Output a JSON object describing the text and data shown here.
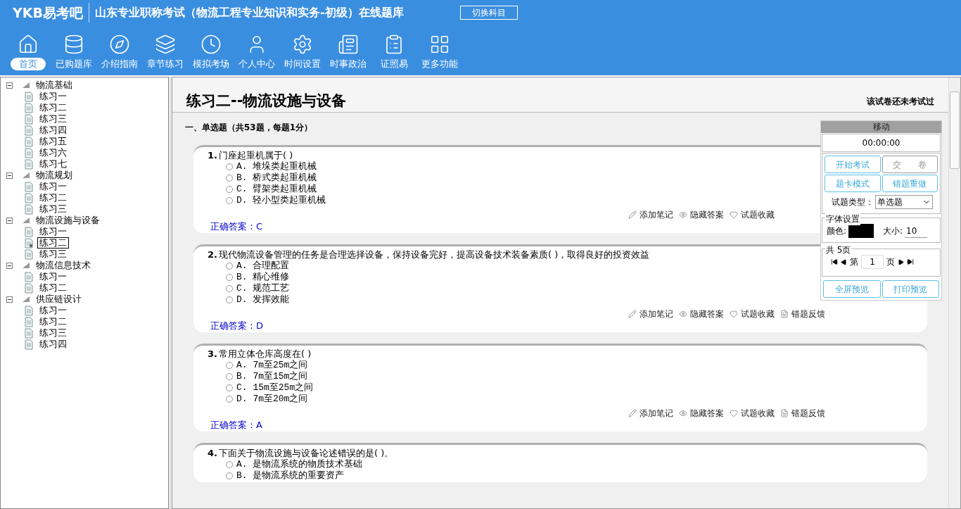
{
  "header": {
    "logo": "YKB易考吧",
    "title": "山东专业职称考试（物流工程专业知识和实务-初级）在线题库",
    "switch_button": "切换科目"
  },
  "nav": [
    {
      "label": "首页",
      "selected": true
    },
    {
      "label": "已购题库",
      "selected": false
    },
    {
      "label": "介绍指南",
      "selected": false
    },
    {
      "label": "章节练习",
      "selected": false
    },
    {
      "label": "模拟考场",
      "selected": false
    },
    {
      "label": "个人中心",
      "selected": false
    },
    {
      "label": "时间设置",
      "selected": false
    },
    {
      "label": "时事政治",
      "selected": false
    },
    {
      "label": "证照易",
      "selected": false
    },
    {
      "label": "更多功能",
      "selected": false
    }
  ],
  "tree": [
    {
      "label": "物流基础",
      "expanded": true,
      "children": [
        {
          "label": "练习一",
          "selected": false
        },
        {
          "label": "练习二",
          "selected": false
        },
        {
          "label": "练习三",
          "selected": false
        },
        {
          "label": "练习四",
          "selected": false
        },
        {
          "label": "练习五",
          "selected": false
        },
        {
          "label": "练习六",
          "selected": false
        },
        {
          "label": "练习七",
          "selected": false
        }
      ]
    },
    {
      "label": "物流规划",
      "expanded": true,
      "children": [
        {
          "label": "练习一",
          "selected": false
        },
        {
          "label": "练习二",
          "selected": false
        },
        {
          "label": "练习三",
          "selected": false
        }
      ]
    },
    {
      "label": "物流设施与设备",
      "expanded": true,
      "children": [
        {
          "label": "练习一",
          "selected": false
        },
        {
          "label": "练习二",
          "selected": true
        },
        {
          "label": "练习三",
          "selected": false
        }
      ]
    },
    {
      "label": "物流信息技术",
      "expanded": true,
      "children": [
        {
          "label": "练习一",
          "selected": false
        },
        {
          "label": "练习二",
          "selected": false
        }
      ]
    },
    {
      "label": "供应链设计",
      "expanded": true,
      "children": [
        {
          "label": "练习一",
          "selected": false
        },
        {
          "label": "练习二",
          "selected": false
        },
        {
          "label": "练习三",
          "selected": false
        },
        {
          "label": "练习四",
          "selected": false
        }
      ]
    }
  ],
  "exam": {
    "title": "练习二--物流设施与设备",
    "status": "该试卷还未考试过",
    "section": "一、单选题（共53题，每题1分）"
  },
  "questions": [
    {
      "number": "1.",
      "text": "门座起重机属于( )",
      "options": [
        {
          "text": "A. 堆垛类起重机械",
          "selected": false
        },
        {
          "text": "B. 桥式类起重机械",
          "selected": false
        },
        {
          "text": "C. 臂架类起重机械",
          "selected": false
        },
        {
          "text": "D. 轻小型类起重机械",
          "selected": false
        }
      ],
      "actions": [
        "添加笔记",
        "隐藏答案",
        "试题收藏"
      ],
      "answer": "正确答案：C"
    },
    {
      "number": "2.",
      "text": "现代物流设备管理的任务是合理选择设备，保持设备完好，提高设备技术装备素质( )，取得良好的投资效益",
      "options": [
        {
          "text": "A. 合理配置",
          "selected": false
        },
        {
          "text": "B. 精心维修",
          "selected": false
        },
        {
          "text": "C. 规范工艺",
          "selected": false
        },
        {
          "text": "D. 发挥效能",
          "selected": false
        }
      ],
      "actions": [
        "添加笔记",
        "隐藏答案",
        "试题收藏",
        "错题反馈"
      ],
      "answer": "正确答案：D"
    },
    {
      "number": "3.",
      "text": "常用立体仓库高度在( )",
      "options": [
        {
          "text": "A. 7m至25m之间",
          "selected": false
        },
        {
          "text": "B. 7m至15m之间",
          "selected": false
        },
        {
          "text": "C. 15m至25m之间",
          "selected": false
        },
        {
          "text": "D. 7m至20m之间",
          "selected": false
        }
      ],
      "actions": [
        "添加笔记",
        "隐藏答案",
        "试题收藏",
        "错题反馈"
      ],
      "answer": "正确答案：A"
    },
    {
      "number": "4.",
      "text": "下面关于物流设施与设备论述错误的是( )。",
      "options": [
        {
          "text": "A. 是物流系统的物质技术基础",
          "selected": false
        },
        {
          "text": "B. 是物流系统的重要资产",
          "selected": false
        }
      ]
    }
  ],
  "panel": {
    "move": "移动",
    "timer": "00:00:00",
    "buttons": [
      {
        "label": "开始考试",
        "disabled": false
      },
      {
        "label": "交　　卷",
        "disabled": true
      },
      {
        "label": "题卡模式",
        "disabled": false
      },
      {
        "label": "错题重做",
        "disabled": false
      }
    ],
    "type_label": "试题类型：",
    "type_value": "单选题",
    "font_group": "字体设置",
    "color_label": "颜色:",
    "size_label": "大小:",
    "size_value": "10",
    "page_group": "共 5页",
    "page_prefix": "第",
    "page_value": "1",
    "page_suffix": "页",
    "bottom_buttons": [
      "全屏预览",
      "打印预览"
    ]
  }
}
